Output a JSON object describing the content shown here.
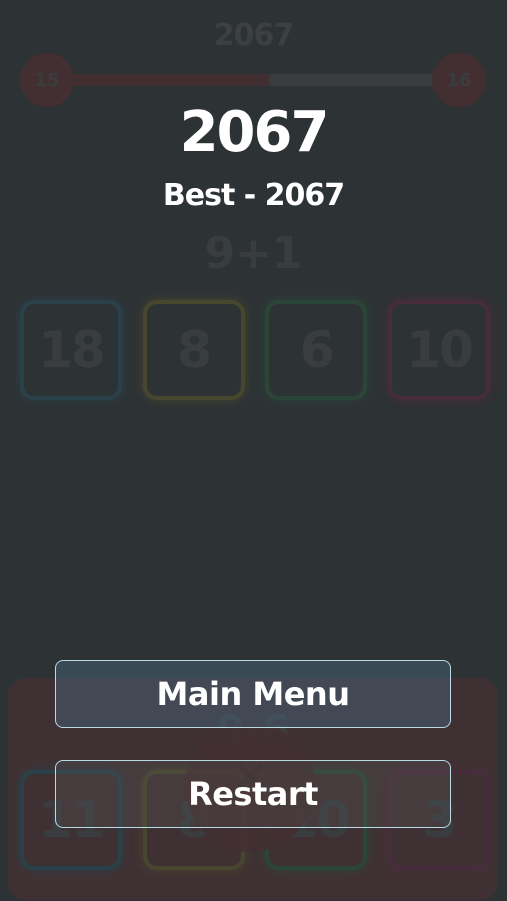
{
  "background_game": {
    "top_score": "2067",
    "level_left": "15",
    "level_right": "16",
    "progress": 0.55,
    "question": "9+1",
    "answers": [
      "18",
      "8",
      "6",
      "10"
    ],
    "lower_question": "9-6",
    "lower_answers": [
      "11",
      "8",
      "10",
      "3"
    ]
  },
  "game_over": {
    "score": "2067",
    "best": "Best - 2067",
    "main_menu_label": "Main Menu",
    "restart_label": "Restart"
  },
  "colors": {
    "blue": "#2da0c8",
    "yellow": "#e3c21e",
    "green": "#2fc45f",
    "pink": "#e3266f",
    "red": "#c9302c"
  }
}
